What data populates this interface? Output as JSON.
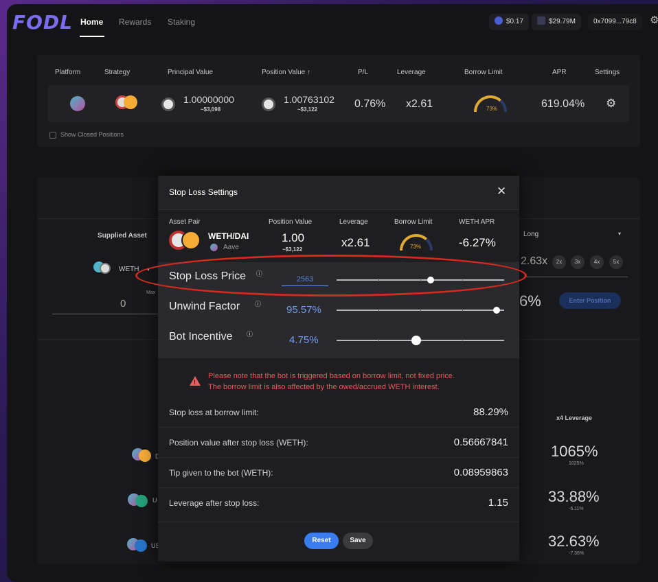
{
  "brand": {
    "name": "FODL"
  },
  "nav": {
    "home": "Home",
    "rewards": "Rewards",
    "staking": "Staking"
  },
  "header": {
    "token_price": "$0.17",
    "tvl": "$29.79M",
    "wallet": "0x7099...79c8"
  },
  "positions_table": {
    "headers": [
      "Platform",
      "Strategy",
      "Principal Value",
      "Position Value ↑",
      "P/L",
      "Leverage",
      "Borrow Limit",
      "APR",
      "Settings"
    ],
    "row": {
      "principal": "1.00000000",
      "principal_usd": "~$3,098",
      "position": "1.00763102",
      "position_usd": "~$3,122",
      "pl": "0.76%",
      "leverage": "x2.61",
      "borrow_limit": "73%",
      "borrow_limit_fraction": 0.73,
      "apr": "619.04%"
    },
    "show_closed": "Show Closed Positions"
  },
  "background_panel": {
    "supplied_asset": "Supplied Asset",
    "asset": "WETH",
    "max_label": "Max",
    "amount": "0",
    "direction": "Long",
    "leverage_value": "2.63x",
    "leverage_options": [
      "2x",
      "3x",
      "4x",
      "5x"
    ],
    "apr_partial": "6%",
    "enter_position": "Enter Position",
    "col_header": "x4 Leverage",
    "rows": [
      {
        "label": "D",
        "big": "1065%",
        "small": "1025%"
      },
      {
        "label": "U",
        "big": "33.88%",
        "small": "-6.11%"
      },
      {
        "label": "US",
        "big": "32.63%",
        "small": "-7.36%"
      }
    ]
  },
  "modal": {
    "title": "Stop Loss Settings",
    "asset_pair_label": "Asset Pair",
    "asset_pair": "WETH/DAI",
    "platform": "Aave",
    "position_value_label": "Position Value",
    "position_value": "1.00",
    "position_value_usd": "~$3,122",
    "leverage_label": "Leverage",
    "leverage": "x2.61",
    "borrow_limit_label": "Borrow Limit",
    "borrow_limit": "73%",
    "borrow_limit_fraction": 0.73,
    "weth_apr_label": "WETH APR",
    "weth_apr": "-6.27%",
    "sliders": [
      {
        "label": "Stop Loss Price",
        "value": "2563",
        "position": 0.56
      },
      {
        "label": "Unwind Factor",
        "value": "95.57%",
        "position": 0.955
      },
      {
        "label": "Bot Incentive",
        "value": "4.75%",
        "position": 0.475
      }
    ],
    "warning_line1": "Please note that the bot is triggered based on borrow limit, not fixed price.",
    "warning_line2": "The borrow limit is also affected by the owed/accrued WETH interest.",
    "results": [
      {
        "label": "Stop loss at borrow limit:",
        "value": "88.29%"
      },
      {
        "label": "Position value after stop loss (WETH):",
        "value": "0.56667841"
      },
      {
        "label": "Tip given to the bot (WETH):",
        "value": "0.08959863"
      },
      {
        "label": "Leverage after stop loss:",
        "value": "1.15"
      }
    ],
    "reset": "Reset",
    "save": "Save"
  }
}
